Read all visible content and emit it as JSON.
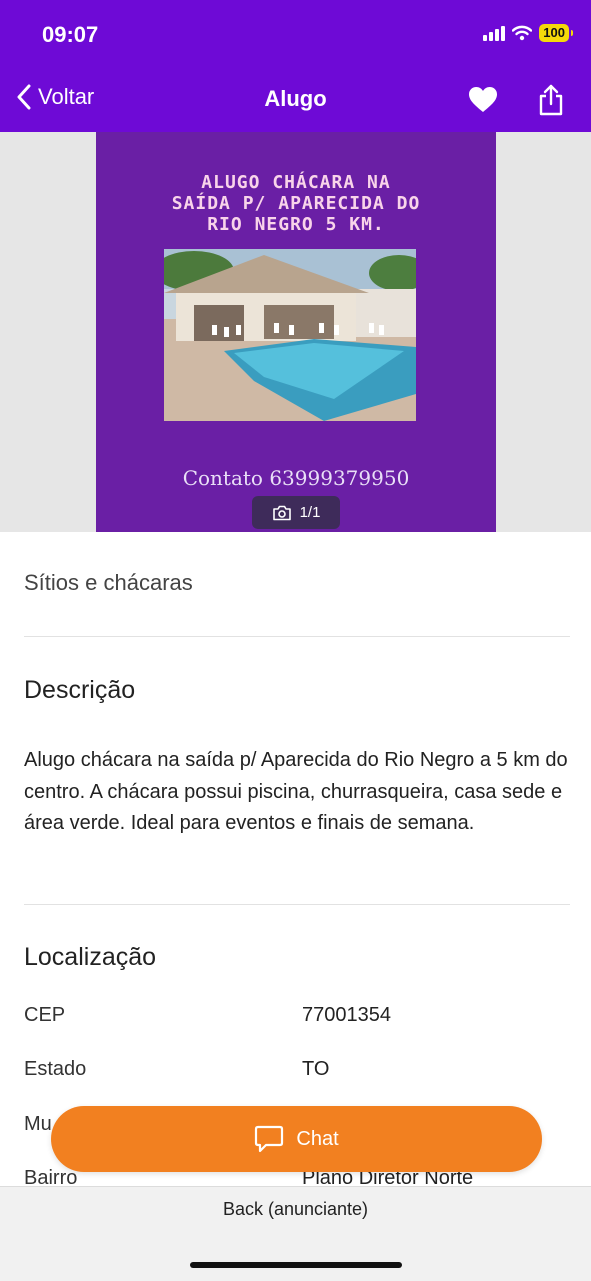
{
  "status_bar": {
    "time": "09:07",
    "battery": "100"
  },
  "nav": {
    "back_label": "Voltar",
    "title": "Alugo"
  },
  "listing": {
    "ad_image": {
      "headline_lines": [
        "ALUGO CHÁCARA NA",
        "SAÍDA P/ APARECIDA DO",
        "RIO NEGRO 5 KM."
      ],
      "contact": "Contato 63999379950"
    },
    "photo_counter": "1/1",
    "category": "Sítios e chácaras",
    "description": {
      "title": "Descrição",
      "text": "Alugo chácara na saída p/ Aparecida do Rio Negro a 5 km do centro. A chácara possui piscina, churrasqueira, casa sede e área verde. Ideal para eventos e finais de semana."
    },
    "location": {
      "title": "Localização",
      "rows": [
        {
          "label": "CEP",
          "value": "77001354"
        },
        {
          "label": "Estado",
          "value": "TO"
        },
        {
          "label": "Mu",
          "value": ""
        },
        {
          "label": "Bairro",
          "value": "Plano Diretor Norte"
        }
      ]
    }
  },
  "actions": {
    "chat_label": "Chat"
  },
  "footer": {
    "advertiser": "Back (anunciante)"
  },
  "colors": {
    "brand_purple": "#6e0ad6",
    "chat_orange": "#f28020",
    "ad_background": "#6a1fa5"
  }
}
